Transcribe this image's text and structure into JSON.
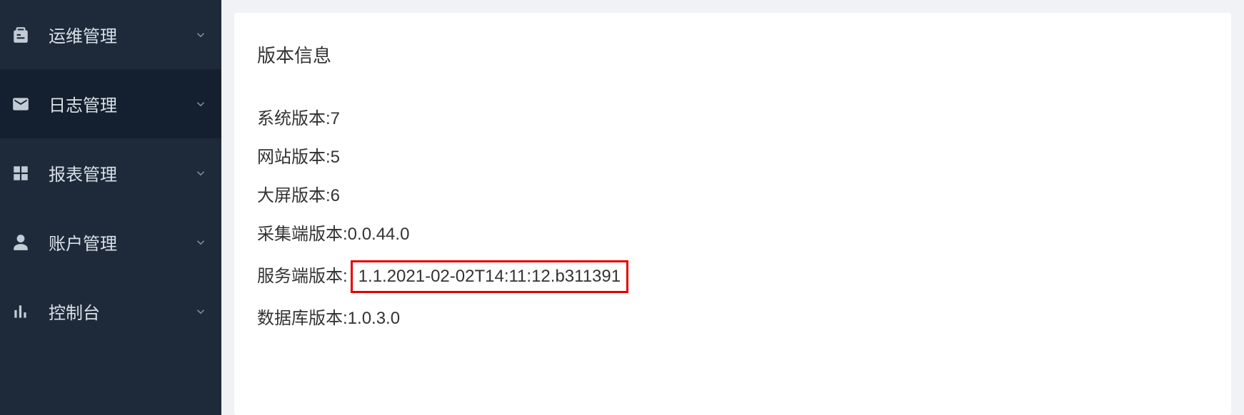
{
  "sidebar": {
    "items": [
      {
        "label": "运维管理"
      },
      {
        "label": "日志管理"
      },
      {
        "label": "报表管理"
      },
      {
        "label": "账户管理"
      },
      {
        "label": "控制台"
      }
    ]
  },
  "main": {
    "title": "版本信息",
    "rows": [
      {
        "label": "系统版本: ",
        "value": "7"
      },
      {
        "label": "网站版本: ",
        "value": "5"
      },
      {
        "label": "大屏版本: ",
        "value": "6"
      },
      {
        "label": "采集端版本: ",
        "value": "0.0.44.0"
      },
      {
        "label": "服务端版本: ",
        "value": "1.1.2021-02-02T14:11:12.b311391"
      },
      {
        "label": "数据库版本: ",
        "value": "1.0.3.0"
      }
    ]
  }
}
